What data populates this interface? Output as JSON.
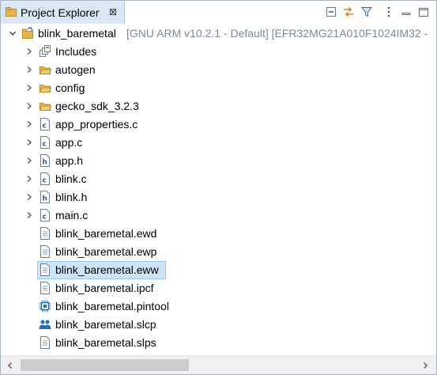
{
  "panel": {
    "title": "Project Explorer",
    "close_glyph": "⊠"
  },
  "toolbar": {
    "buttons": [
      "collapse-all-icon",
      "link-with-editor-icon",
      "filter-icon",
      "view-menu-icon",
      "minimize-icon",
      "maximize-icon"
    ]
  },
  "tree": {
    "project": {
      "name": "blink_baremetal",
      "decoration": "[GNU ARM v10.2.1 - Default] [EFR32MG21A010F1024IM32 -"
    },
    "items": [
      {
        "label": "Includes",
        "icon": "includes-icon",
        "expandable": true
      },
      {
        "label": "autogen",
        "icon": "folder-icon",
        "expandable": true
      },
      {
        "label": "config",
        "icon": "folder-icon",
        "expandable": true
      },
      {
        "label": "gecko_sdk_3.2.3",
        "icon": "folder-icon",
        "expandable": true
      },
      {
        "label": "app_properties.c",
        "icon": "c-file-icon",
        "expandable": true
      },
      {
        "label": "app.c",
        "icon": "c-file-icon",
        "expandable": true
      },
      {
        "label": "app.h",
        "icon": "h-file-icon",
        "expandable": true
      },
      {
        "label": "blink.c",
        "icon": "c-file-icon",
        "expandable": true
      },
      {
        "label": "blink.h",
        "icon": "h-file-icon",
        "expandable": true
      },
      {
        "label": "main.c",
        "icon": "c-file-icon",
        "expandable": true
      },
      {
        "label": "blink_baremetal.ewd",
        "icon": "text-file-icon",
        "expandable": false
      },
      {
        "label": "blink_baremetal.ewp",
        "icon": "text-file-icon",
        "expandable": false
      },
      {
        "label": "blink_baremetal.eww",
        "icon": "text-file-icon",
        "expandable": false,
        "selected": true
      },
      {
        "label": "blink_baremetal.ipcf",
        "icon": "text-file-icon",
        "expandable": false
      },
      {
        "label": "blink_baremetal.pintool",
        "icon": "chip-icon",
        "expandable": false
      },
      {
        "label": "blink_baremetal.slcp",
        "icon": "slcp-icon",
        "expandable": false
      },
      {
        "label": "blink_baremetal.slps",
        "icon": "text-file-icon",
        "expandable": false
      }
    ]
  },
  "colors": {
    "tab_bg": "#d9e7f7",
    "selection_bg": "#cce4f7",
    "decoration_text": "#7a8c9e",
    "folder": "#e8b54a"
  }
}
